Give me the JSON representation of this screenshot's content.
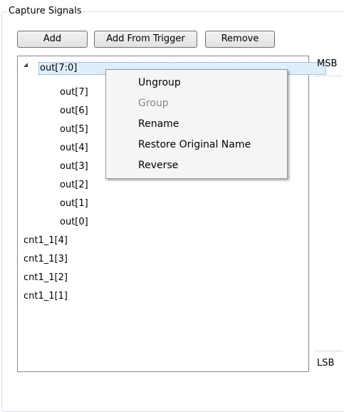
{
  "panel": {
    "title": "Capture Signals"
  },
  "toolbar": {
    "add_label": "Add",
    "add_from_trigger_label": "Add From Trigger",
    "remove_label": "Remove"
  },
  "tree": {
    "group_label": "out[7:0]",
    "group_children": [
      "out[7]",
      "out[6]",
      "out[5]",
      "out[4]",
      "out[3]",
      "out[2]",
      "out[1]",
      "out[0]"
    ],
    "other_items": [
      "cnt1_1[4]",
      "cnt1_1[3]",
      "cnt1_1[2]",
      "cnt1_1[1]"
    ]
  },
  "side": {
    "top_label": "MSB",
    "bottom_label": "LSB"
  },
  "context_menu": {
    "items": [
      {
        "label": "Ungroup",
        "enabled": true
      },
      {
        "label": "Group",
        "enabled": false
      },
      {
        "label": "Rename",
        "enabled": true
      },
      {
        "label": "Restore Original Name",
        "enabled": true
      },
      {
        "label": "Reverse",
        "enabled": true
      }
    ]
  }
}
